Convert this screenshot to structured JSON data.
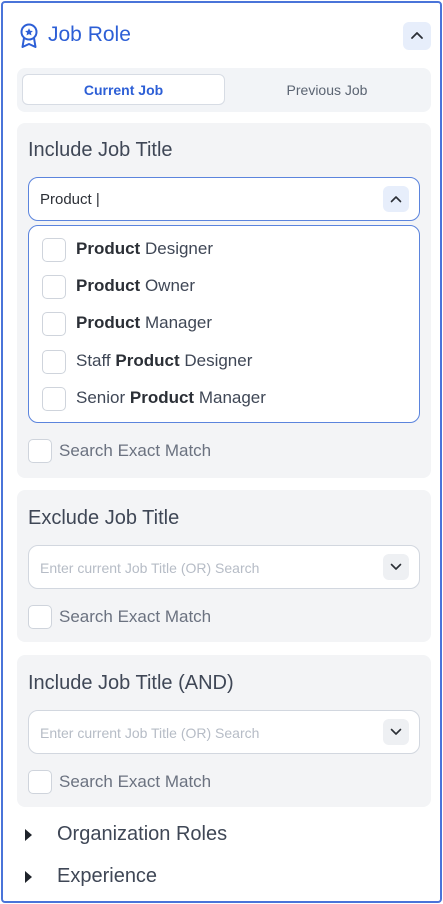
{
  "header": {
    "title": "Job Role",
    "icon": "award-badge-icon"
  },
  "tabs": [
    {
      "label": "Current Job",
      "active": true
    },
    {
      "label": "Previous Job",
      "active": false
    }
  ],
  "include": {
    "title": "Include Job Title",
    "input_value": "Product |",
    "options": [
      {
        "pre": "",
        "bold": "Product",
        "post": " Designer"
      },
      {
        "pre": "",
        "bold": "Product",
        "post": " Owner"
      },
      {
        "pre": "",
        "bold": "Product",
        "post": " Manager"
      },
      {
        "pre": "Staff ",
        "bold": "Product",
        "post": " Designer"
      },
      {
        "pre": "Senior ",
        "bold": "Product",
        "post": " Manager"
      }
    ],
    "exact_label": "Search Exact Match"
  },
  "exclude": {
    "title": "Exclude Job Title",
    "placeholder": "Enter current Job Title (OR) Search",
    "exact_label": "Search Exact Match"
  },
  "include_and": {
    "title": "Include Job Title (AND)",
    "placeholder": "Enter current Job Title (OR) Search",
    "exact_label": "Search Exact Match"
  },
  "accordions": [
    {
      "label": "Organization Roles"
    },
    {
      "label": "Experience"
    }
  ],
  "colors": {
    "accent": "#2d5fd6",
    "border_focus": "#5b84dd",
    "section_bg": "#f3f4f6"
  }
}
